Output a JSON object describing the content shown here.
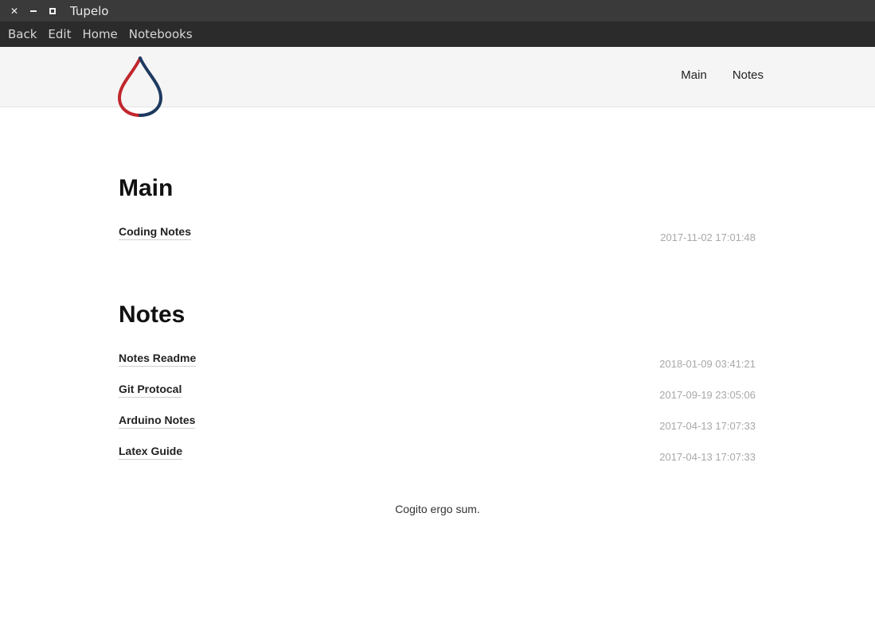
{
  "window": {
    "title": "Tupelo"
  },
  "menubar": {
    "items": [
      {
        "label": "Back"
      },
      {
        "label": "Edit"
      },
      {
        "label": "Home"
      },
      {
        "label": "Notebooks"
      }
    ]
  },
  "header": {
    "logo_icon": "droplet-icon",
    "logo_colors": {
      "left": "#c1272d",
      "right": "#1f3a60"
    },
    "nav": [
      {
        "label": "Main"
      },
      {
        "label": "Notes"
      }
    ]
  },
  "sections": [
    {
      "title": "Main",
      "entries": [
        {
          "title": "Coding Notes",
          "date": "2017-11-02 17:01:48"
        }
      ]
    },
    {
      "title": "Notes",
      "entries": [
        {
          "title": "Notes Readme",
          "date": "2018-01-09 03:41:21"
        },
        {
          "title": "Git Protocal",
          "date": "2017-09-19 23:05:06"
        },
        {
          "title": "Arduino Notes",
          "date": "2017-04-13 17:07:33"
        },
        {
          "title": "Latex Guide",
          "date": "2017-04-13 17:07:33"
        }
      ]
    }
  ],
  "footer": {
    "text": "Cogito ergo sum."
  }
}
